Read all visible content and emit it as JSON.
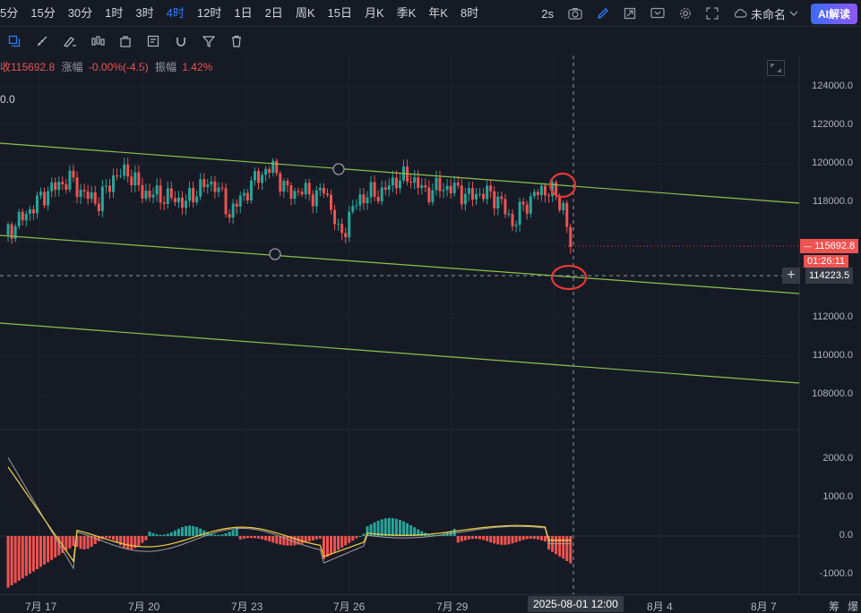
{
  "timeframes": [
    "5分",
    "15分",
    "30分",
    "1时",
    "3时",
    "4时",
    "12时",
    "1日",
    "2日",
    "周K",
    "15日",
    "月K",
    "季K",
    "年K",
    "8时"
  ],
  "active_timeframe": "4时",
  "topright": {
    "interval": "2s",
    "layout_name": "未命名",
    "ai_button": "AI解读"
  },
  "info_bar": {
    "price_prefix": "收",
    "price": "115692.8",
    "change_label": "涨幅",
    "change_value": "-0.00%(-4.5)",
    "amplitude_label": "振幅",
    "amplitude_value": "1.42%"
  },
  "indicator_note": "0.0",
  "price_axis": [
    "124000.0",
    "122000.0",
    "120000.0",
    "118000.0",
    "112000.0",
    "110000.0",
    "108000.0"
  ],
  "current_price_tag": "115692.8",
  "countdown_tag": "01:26:11",
  "crosshair_price": "114223.5",
  "macd_axis": [
    "2000.0",
    "1000.0",
    "0.0",
    "-1000.0"
  ],
  "date_labels": [
    "7月 17",
    "7月 20",
    "7月 23",
    "7月 26",
    "7月 29",
    "8月 4",
    "8月 7"
  ],
  "crosshair_date": "2025-08-01 12:00",
  "corner_labels": [
    "筹",
    "爆"
  ],
  "colors": {
    "up": "#26a69a",
    "down": "#ef5350",
    "channel": "#8bc34a",
    "marker": "#e53935",
    "accent": "#2e7bf6"
  },
  "chart_data": {
    "type": "candlestick",
    "price_range": [
      107000,
      125000
    ],
    "channel_lines": "three parallel descending trend lines",
    "macd_range": [
      -1500,
      2500
    ]
  }
}
